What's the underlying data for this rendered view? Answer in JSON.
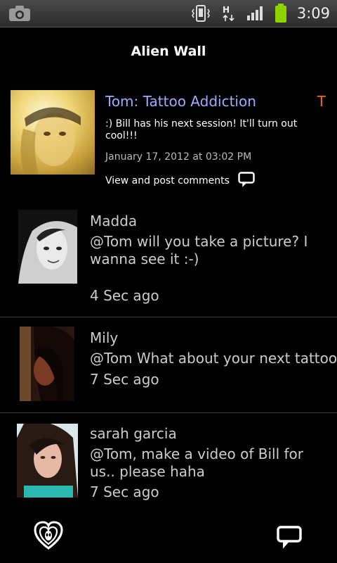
{
  "status_bar": {
    "time": "3:09",
    "network_letter": "H",
    "icons": [
      "camera-icon",
      "vibrate-icon",
      "network-data-icon",
      "signal-icon",
      "battery-icon"
    ]
  },
  "header": {
    "title": "Alien Wall"
  },
  "post": {
    "author": "Tom: Tattoo Addiction",
    "initial": "T",
    "text": ":) Bill has his next session! It'll turn out cool!!!",
    "date": "January 17, 2012 at 03:02 PM",
    "comments_link": "View and post comments"
  },
  "comments": [
    {
      "name": "Madda",
      "text": "@Tom will you take a picture? I wanna see it :-)",
      "time": "4 Sec ago"
    },
    {
      "name": "Mily",
      "text": "@Tom What about your next tattoo?",
      "time": "7 Sec ago"
    },
    {
      "name": "sarah garcia",
      "text": "@Tom, make a video of Bill for us.. please haha",
      "time": "7 Sec ago"
    }
  ],
  "colors": {
    "author": "#a8a7ff",
    "initial": "#f26a1a",
    "background": "#000000"
  }
}
